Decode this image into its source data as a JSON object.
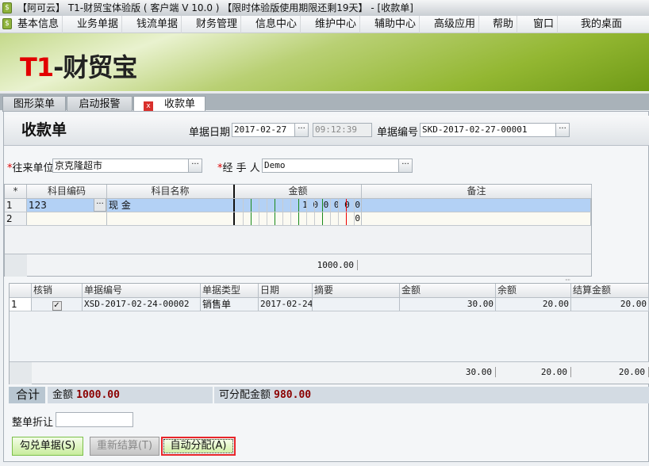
{
  "window_title": "【阿可云】 T1-财贸宝体验版 ( 客户端 V 10.0 ) 【限时体验版使用期限还剩19天】 - [收款单]",
  "menu": [
    "基本信息",
    "业务单据",
    "钱流单据",
    "财务管理",
    "信息中心",
    "维护中心",
    "辅助中心",
    "高级应用",
    "帮助",
    "窗口",
    "我的桌面"
  ],
  "logo": {
    "t1": "T1",
    "rest": "-财贸宝"
  },
  "tabs": [
    "图形菜单",
    "启动报警",
    "收款单"
  ],
  "form": {
    "title": "收款单",
    "date_label": "单据日期",
    "date": "2017-02-27",
    "time": "09:12:39",
    "no_label": "单据编号",
    "no": "SKD-2017-02-27-00001",
    "partner_label": "往来单位",
    "partner": "京克隆超市",
    "handler_label": "经 手 人",
    "handler": "Demo",
    "more": "···",
    "required": "*"
  },
  "grid1": {
    "headers": [
      "*",
      "科目编码",
      "科目名称",
      "金额",
      "备注"
    ],
    "rows": [
      {
        "n": "1",
        "code": "123",
        "name": "现    金",
        "amount_digits": "1 0 0 0 0 0",
        "note": ""
      },
      {
        "n": "2",
        "code": "",
        "name": "",
        "amount_digits": "0",
        "note": ""
      }
    ],
    "total": "1000.00"
  },
  "grid2": {
    "headers": [
      "",
      "核销",
      "单据编号",
      "单据类型",
      "日期",
      "摘要",
      "金额",
      "余额",
      "结算金额"
    ],
    "rows": [
      {
        "n": "1",
        "checked": true,
        "no": "XSD-2017-02-24-00002",
        "type": "销售单",
        "date": "2017-02-24",
        "memo": "",
        "amount": "30.00",
        "balance": "20.00",
        "settle": "20.00"
      }
    ],
    "totals": {
      "amount": "30.00",
      "balance": "20.00",
      "settle": "20.00"
    }
  },
  "summary": {
    "label": "合计",
    "amount_label": "金额",
    "amount": "1000.00",
    "alloc_label": "可分配金额",
    "alloc": "980.00"
  },
  "discount_label": "整单折让",
  "discount": "",
  "buttons": {
    "check": "勾兑单据(S)",
    "recalc": "重新结算(T)",
    "auto": "自动分配(A)"
  }
}
